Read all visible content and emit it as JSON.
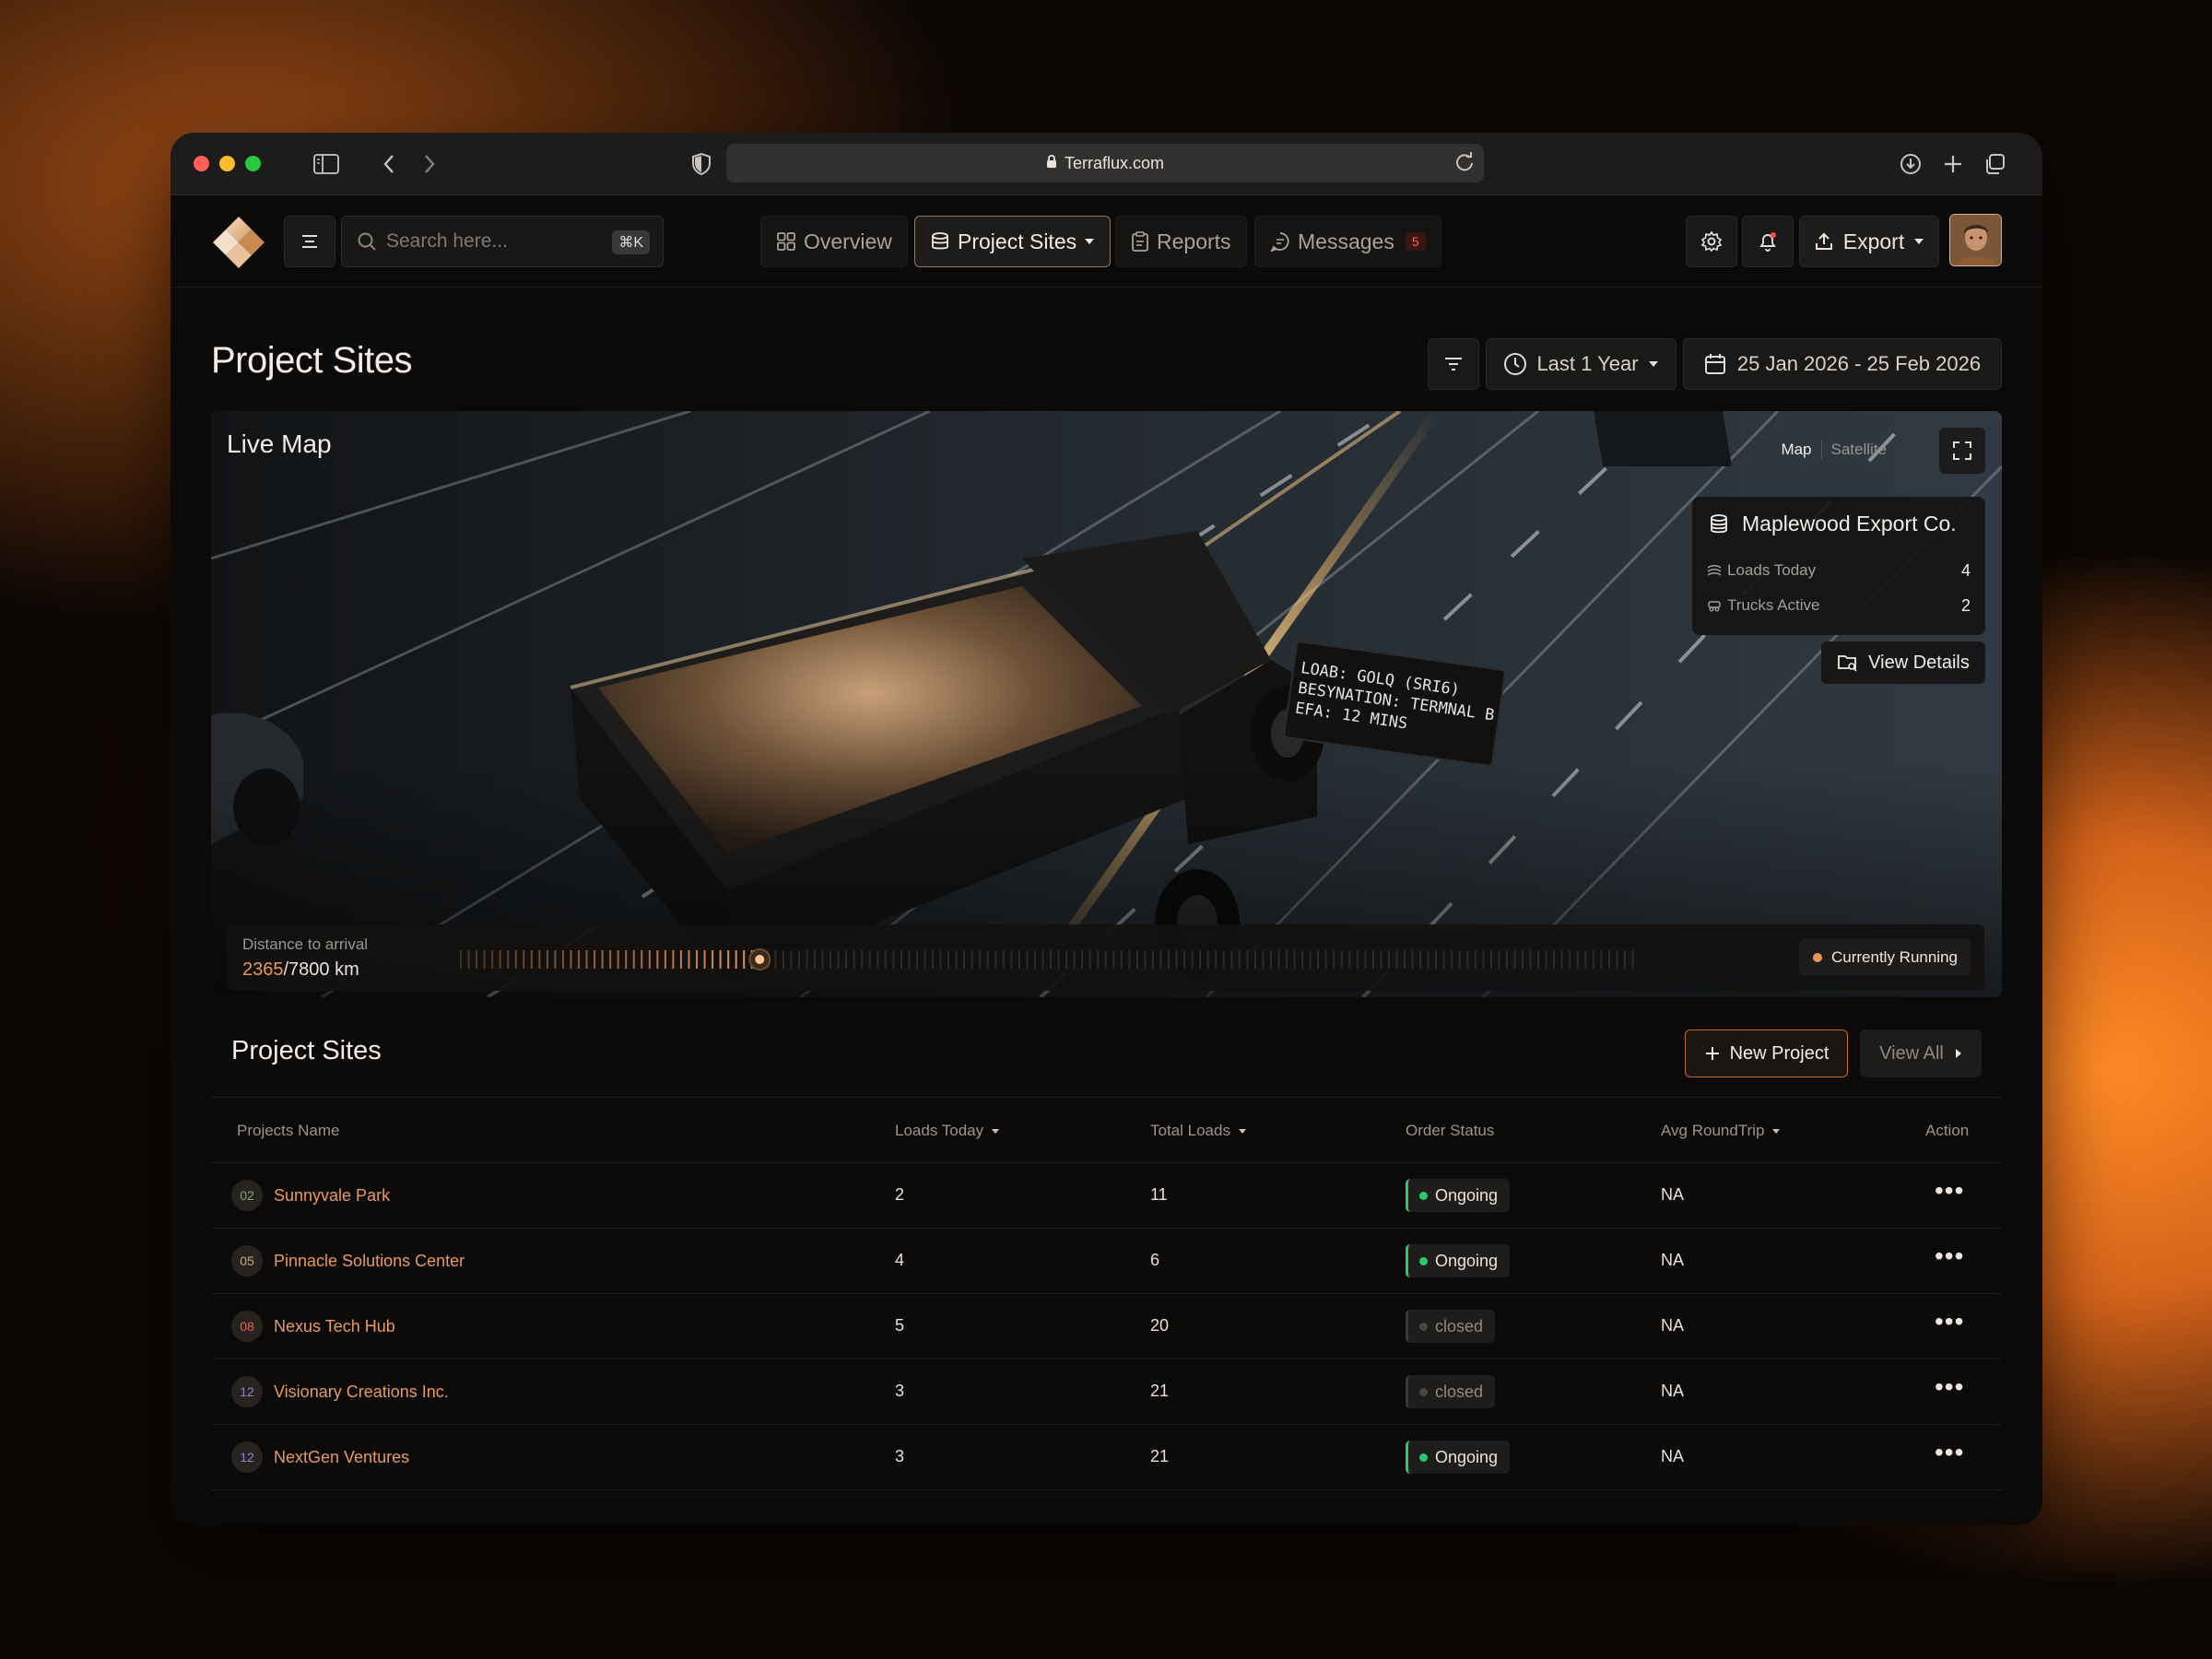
{
  "browser": {
    "url": "Terraflux.com"
  },
  "header": {
    "search_placeholder": "Search here...",
    "search_shortcut": "⌘K",
    "nav": [
      {
        "label": "Overview"
      },
      {
        "label": "Project Sites"
      },
      {
        "label": "Reports"
      },
      {
        "label": "Messages",
        "badge": "5"
      }
    ],
    "export_label": "Export"
  },
  "page": {
    "title": "Project Sites",
    "range_label": "Last 1 Year",
    "date_range": "25 Jan 2026 - 25 Feb 2026"
  },
  "map": {
    "title": "Live Map",
    "toggle_map": "Map",
    "toggle_satellite": "Satellite",
    "info": {
      "company": "Maplewood Export Co.",
      "loads_label": "Loads Today",
      "loads_value": "4",
      "trucks_label": "Trucks Active",
      "trucks_value": "2",
      "view_details": "View Details"
    },
    "sign": {
      "line1": "LOAB: GOLQ (SRI6)",
      "line2": "BESYNATION: TERMNAL B",
      "line3": "EFA: 12 MINS"
    },
    "distance": {
      "label": "Distance to arrival",
      "current": "2365",
      "total": "/7800 km",
      "progress": 0.3032
    },
    "status": "Currently Running"
  },
  "projects": {
    "title": "Project Sites",
    "new_label": "New Project",
    "view_all_label": "View All",
    "columns": {
      "name": "Projects Name",
      "loads_today": "Loads Today",
      "total_loads": "Total Loads",
      "order_status": "Order Status",
      "avg_roundtrip": "Avg RoundTrip",
      "action": "Action"
    },
    "rows": [
      {
        "badge": "02",
        "badge_color": "#7fa46a",
        "name": "Sunnyvale Park",
        "loads_today": "2",
        "total_loads": "11",
        "status": "Ongoing",
        "avg": "NA"
      },
      {
        "badge": "05",
        "badge_color": "#c9a77a",
        "name": "Pinnacle Solutions Center",
        "loads_today": "4",
        "total_loads": "6",
        "status": "Ongoing",
        "avg": "NA"
      },
      {
        "badge": "08",
        "badge_color": "#e0604d",
        "name": "Nexus Tech Hub",
        "loads_today": "5",
        "total_loads": "20",
        "status": "closed",
        "avg": "NA"
      },
      {
        "badge": "12",
        "badge_color": "#8a86c8",
        "name": "Visionary Creations Inc.",
        "loads_today": "3",
        "total_loads": "21",
        "status": "closed",
        "avg": "NA"
      },
      {
        "badge": "12",
        "badge_color": "#8a86c8",
        "name": "NextGen Ventures",
        "loads_today": "3",
        "total_loads": "21",
        "status": "Ongoing",
        "avg": "NA"
      }
    ]
  },
  "colors": {
    "accent": "#e9965a",
    "ongoing": "#29c870"
  }
}
